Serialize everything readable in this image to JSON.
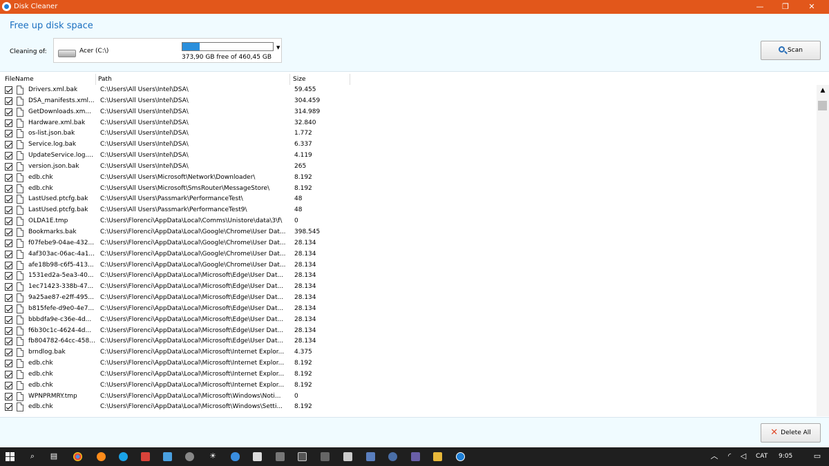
{
  "window": {
    "title": "Disk Cleaner",
    "controls": {
      "minimize": "—",
      "maximize": "❐",
      "close": "✕"
    }
  },
  "header": {
    "heading": "Free up disk space",
    "cleaning_label": "Cleaning of:",
    "drive": {
      "name": "Acer (C:\\)",
      "free_text": "373,90 GB free of 460,45 GB",
      "used_fraction": 0.19
    },
    "scan_button": "Scan"
  },
  "table": {
    "columns": [
      "FileName",
      "Path",
      "Size"
    ],
    "rows": [
      {
        "name": "Drivers.xml.bak",
        "path": "C:\\Users\\All Users\\Intel\\DSA\\",
        "size": "59.455"
      },
      {
        "name": "DSA_manifests.xml...",
        "path": "C:\\Users\\All Users\\Intel\\DSA\\",
        "size": "304.459"
      },
      {
        "name": "GetDownloads.xm...",
        "path": "C:\\Users\\All Users\\Intel\\DSA\\",
        "size": "314.989"
      },
      {
        "name": "Hardware.xml.bak",
        "path": "C:\\Users\\All Users\\Intel\\DSA\\",
        "size": "32.840"
      },
      {
        "name": "os-list.json.bak",
        "path": "C:\\Users\\All Users\\Intel\\DSA\\",
        "size": "1.772"
      },
      {
        "name": "Service.log.bak",
        "path": "C:\\Users\\All Users\\Intel\\DSA\\",
        "size": "6.337"
      },
      {
        "name": "UpdateService.log....",
        "path": "C:\\Users\\All Users\\Intel\\DSA\\",
        "size": "4.119"
      },
      {
        "name": "version.json.bak",
        "path": "C:\\Users\\All Users\\Intel\\DSA\\",
        "size": "265"
      },
      {
        "name": "edb.chk",
        "path": "C:\\Users\\All Users\\Microsoft\\Network\\Downloader\\",
        "size": "8.192"
      },
      {
        "name": "edb.chk",
        "path": "C:\\Users\\All Users\\Microsoft\\SmsRouter\\MessageStore\\",
        "size": "8.192"
      },
      {
        "name": "LastUsed.ptcfg.bak",
        "path": "C:\\Users\\All Users\\Passmark\\PerformanceTest\\",
        "size": "48"
      },
      {
        "name": "LastUsed.ptcfg.bak",
        "path": "C:\\Users\\All Users\\Passmark\\PerformanceTest9\\",
        "size": "48"
      },
      {
        "name": "OLDA1E.tmp",
        "path": "C:\\Users\\Florenci\\AppData\\Local\\Comms\\Unistore\\data\\3\\f\\",
        "size": "0"
      },
      {
        "name": "Bookmarks.bak",
        "path": "C:\\Users\\Florenci\\AppData\\Local\\Google\\Chrome\\User Dat...",
        "size": "398.545"
      },
      {
        "name": "f07febe9-04ae-432...",
        "path": "C:\\Users\\Florenci\\AppData\\Local\\Google\\Chrome\\User Dat...",
        "size": "28.134"
      },
      {
        "name": "4af303ac-06ac-4a1...",
        "path": "C:\\Users\\Florenci\\AppData\\Local\\Google\\Chrome\\User Dat...",
        "size": "28.134"
      },
      {
        "name": "afe18b98-c6f5-413...",
        "path": "C:\\Users\\Florenci\\AppData\\Local\\Google\\Chrome\\User Dat...",
        "size": "28.134"
      },
      {
        "name": "1531ed2a-5ea3-40...",
        "path": "C:\\Users\\Florenci\\AppData\\Local\\Microsoft\\Edge\\User Dat...",
        "size": "28.134"
      },
      {
        "name": "1ec71423-338b-47...",
        "path": "C:\\Users\\Florenci\\AppData\\Local\\Microsoft\\Edge\\User Dat...",
        "size": "28.134"
      },
      {
        "name": "9a25ae87-e2ff-495...",
        "path": "C:\\Users\\Florenci\\AppData\\Local\\Microsoft\\Edge\\User Dat...",
        "size": "28.134"
      },
      {
        "name": "b815fefe-d9e0-4e7...",
        "path": "C:\\Users\\Florenci\\AppData\\Local\\Microsoft\\Edge\\User Dat...",
        "size": "28.134"
      },
      {
        "name": "bbbdfa9e-c36e-4d...",
        "path": "C:\\Users\\Florenci\\AppData\\Local\\Microsoft\\Edge\\User Dat...",
        "size": "28.134"
      },
      {
        "name": "f6b30c1c-4624-4d...",
        "path": "C:\\Users\\Florenci\\AppData\\Local\\Microsoft\\Edge\\User Dat...",
        "size": "28.134"
      },
      {
        "name": "fb804782-64cc-458...",
        "path": "C:\\Users\\Florenci\\AppData\\Local\\Microsoft\\Edge\\User Dat...",
        "size": "28.134"
      },
      {
        "name": "brndlog.bak",
        "path": "C:\\Users\\Florenci\\AppData\\Local\\Microsoft\\Internet Explor...",
        "size": "4.375"
      },
      {
        "name": "edb.chk",
        "path": "C:\\Users\\Florenci\\AppData\\Local\\Microsoft\\Internet Explor...",
        "size": "8.192"
      },
      {
        "name": "edb.chk",
        "path": "C:\\Users\\Florenci\\AppData\\Local\\Microsoft\\Internet Explor...",
        "size": "8.192"
      },
      {
        "name": "edb.chk",
        "path": "C:\\Users\\Florenci\\AppData\\Local\\Microsoft\\Internet Explor...",
        "size": "8.192"
      },
      {
        "name": "WPNPRMRY.tmp",
        "path": "C:\\Users\\Florenci\\AppData\\Local\\Microsoft\\Windows\\Noti...",
        "size": "0"
      },
      {
        "name": "edb.chk",
        "path": "C:\\Users\\Florenci\\AppData\\Local\\Microsoft\\Windows\\Setti...",
        "size": "8.192"
      }
    ]
  },
  "footer": {
    "delete_button": "Delete All"
  },
  "taskbar": {
    "icons": [
      "windows-start-icon",
      "search-icon",
      "task-view-icon",
      "chrome-icon",
      "firefox-icon",
      "edge-icon",
      "app-icon",
      "app-icon",
      "app-icon",
      "weather-icon",
      "onedrive-icon",
      "camera-icon",
      "calculator-icon",
      "store-icon",
      "app-icon",
      "app-icon",
      "app-icon",
      "app-icon",
      "app-icon",
      "file-explorer-icon",
      "disk-cleaner-icon"
    ],
    "language": "CAT",
    "time": "9:05"
  }
}
